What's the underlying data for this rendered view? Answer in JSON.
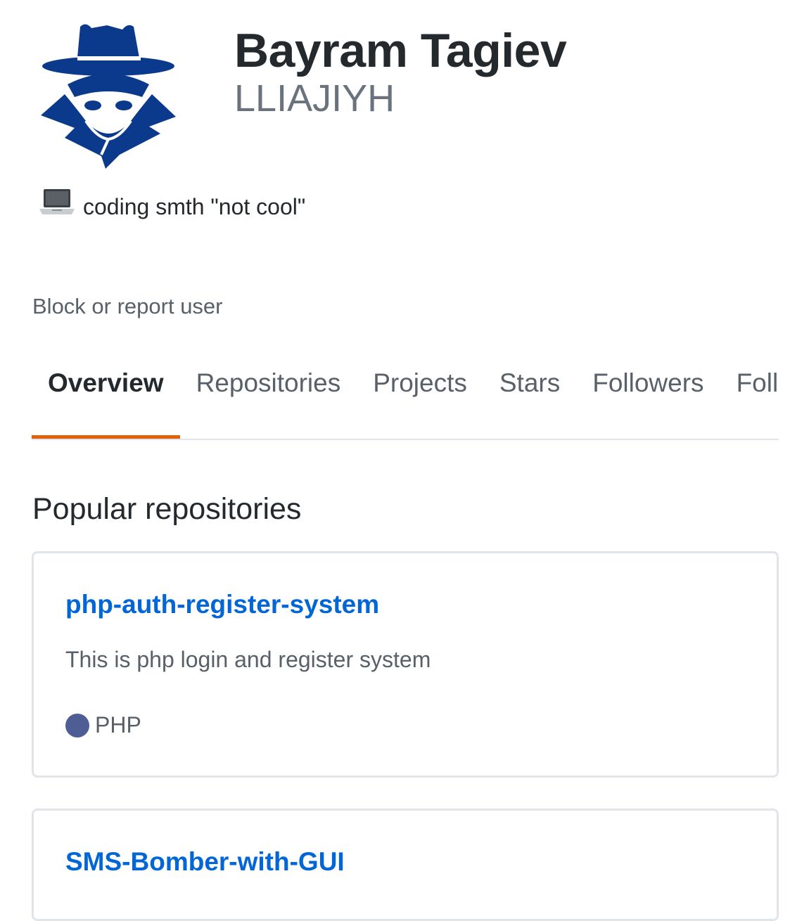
{
  "profile": {
    "full_name": "Bayram Tagiev",
    "username": "LLIAJIYH",
    "avatar_icon": "spy-icon",
    "avatar_color": "#0b3a8c"
  },
  "status": {
    "emoji_icon": "laptop-icon",
    "text": "coding smth \"not cool\""
  },
  "block_report_label": "Block or report user",
  "tabs": [
    {
      "label": "Overview",
      "active": true
    },
    {
      "label": "Repositories",
      "active": false
    },
    {
      "label": "Projects",
      "active": false
    },
    {
      "label": "Stars",
      "active": false
    },
    {
      "label": "Followers",
      "active": false
    },
    {
      "label": "Following",
      "active": false
    }
  ],
  "tab_underline_color": "#e36209",
  "popular": {
    "title": "Popular repositories",
    "repos": [
      {
        "name": "php-auth-register-system",
        "description": "This is php login and register system",
        "language": "PHP",
        "language_color": "#4f5d95"
      },
      {
        "name": "SMS-Bomber-with-GUI"
      }
    ]
  }
}
